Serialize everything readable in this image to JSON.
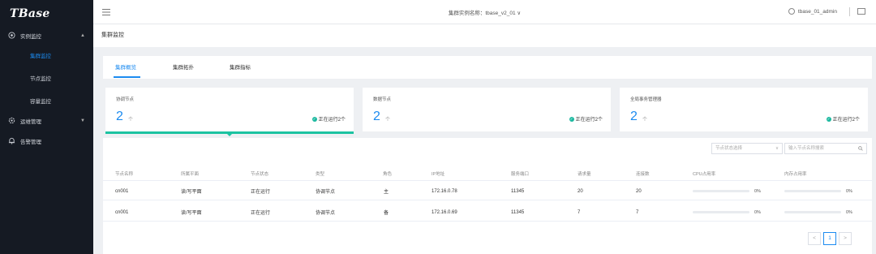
{
  "app": {
    "logo": "TBase"
  },
  "sidebar": {
    "groups": [
      {
        "label": "实例监控",
        "icon": "monitor-icon",
        "expanded": true,
        "items": [
          "集群监控",
          "节点监控",
          "容量监控"
        ],
        "active_index": 0
      },
      {
        "label": "运维管理",
        "icon": "gear-icon",
        "expanded": false
      },
      {
        "label": "告警管理",
        "icon": "bell-icon",
        "expanded": null
      }
    ]
  },
  "topbar": {
    "cluster_label": "集群实例名称：tbase_v2_01",
    "username": "tbase_01_admin"
  },
  "breadcrumb": "集群监控",
  "tabs": {
    "items": [
      "集群概览",
      "集群拓扑",
      "集群指标"
    ],
    "active_index": 0
  },
  "stats": [
    {
      "title": "协调节点",
      "count": "2",
      "unit": "个",
      "status": "正在运行2个"
    },
    {
      "title": "数据节点",
      "count": "2",
      "unit": "个",
      "status": "正在运行2个"
    },
    {
      "title": "全局事务管理器",
      "count": "2",
      "unit": "个",
      "status": "正在运行2个"
    }
  ],
  "filters": {
    "status_placeholder": "节点状态选择",
    "search_placeholder": "输入节点名称搜索"
  },
  "table": {
    "columns": [
      "节点名称",
      "所属平面",
      "节点状态",
      "类型",
      "角色",
      "IP地址",
      "服务端口",
      "请求量",
      "连接数",
      "CPU占用率",
      "内存占用率"
    ],
    "rows": [
      {
        "name": "cn001",
        "plane": "读/写平面",
        "state": "正在运行",
        "type": "协调节点",
        "role": "主",
        "ip": "172.16.0.78",
        "port": "11345",
        "requests": "20",
        "connections": "20",
        "cpu": "0%",
        "cpu_value": 0,
        "mem": "0%",
        "mem_value": 0
      },
      {
        "name": "cn001",
        "plane": "读/写平面",
        "state": "正在运行",
        "type": "协调节点",
        "role": "备",
        "ip": "172.16.0.69",
        "port": "11345",
        "requests": "7",
        "connections": "7",
        "cpu": "0%",
        "cpu_value": 0,
        "mem": "0%",
        "mem_value": 0
      }
    ]
  },
  "pagination": {
    "prev": "<",
    "current": "1",
    "next": ">"
  },
  "colors": {
    "accent": "#1c8bf0",
    "success": "#1cc3a1",
    "sidebar_bg": "#151a23"
  }
}
